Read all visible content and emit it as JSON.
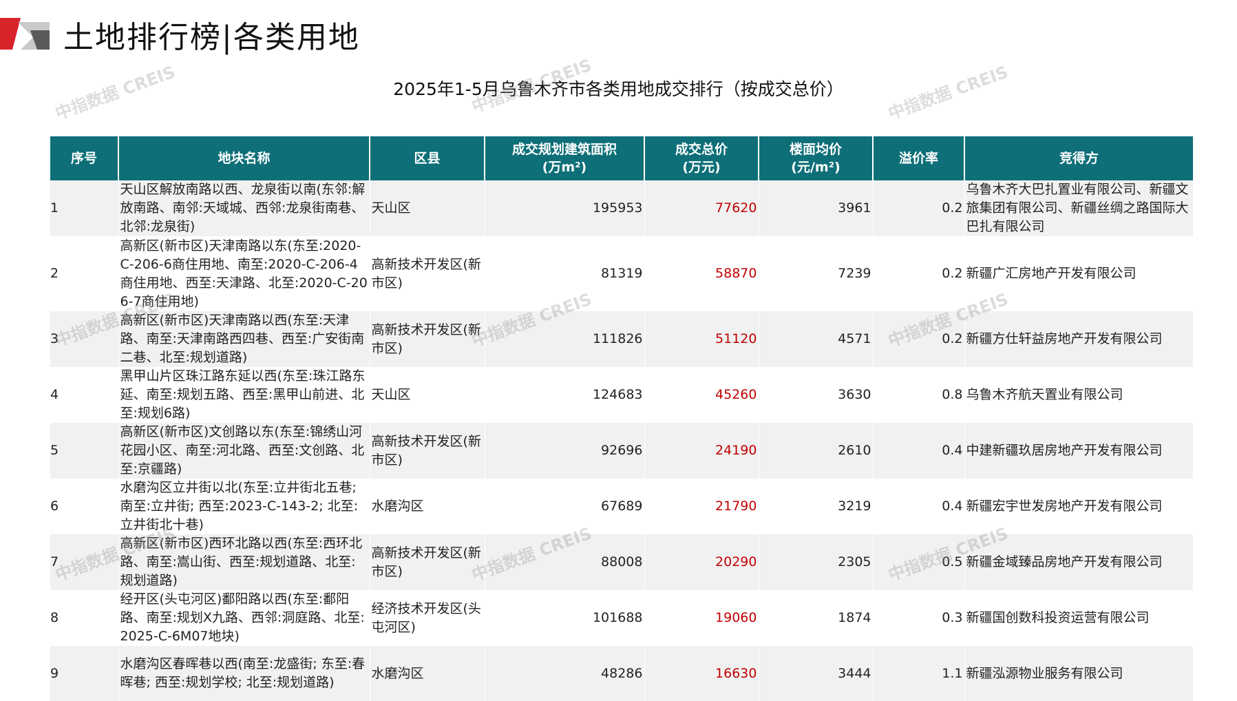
{
  "header": {
    "title": "土地排行榜|各类用地",
    "subtitle": "2025年1-5月乌鲁木齐市各类用地成交排行（按成交总价）",
    "watermark": "中指数据 CREIS"
  },
  "colors": {
    "header_bg": "#0e6f78",
    "price_red": "#c00000",
    "logo_red": "#d9232b"
  },
  "table": {
    "headers": [
      "序号",
      "地块名称",
      "区县",
      "成交规划建筑面积\n(万m²)",
      "成交总价\n(万元)",
      "楼面均价\n(元/m²)",
      "溢价率",
      "竞得方"
    ],
    "rows": [
      {
        "idx": "1",
        "name": "天山区解放南路以西、龙泉街以南(东邻:解放南路、南邻:天域城、西邻:龙泉街南巷、北邻:龙泉街)",
        "district": "天山区",
        "area": "195953",
        "price": "77620",
        "unit_price": "3961",
        "premium": "0.2",
        "winner": "乌鲁木齐大巴扎置业有限公司、新疆文旅集团有限公司、新疆丝绸之路国际大巴扎有限公司"
      },
      {
        "idx": "2",
        "name": "高新区(新市区)天津南路以东(东至:2020-C-206-6商住用地、南至:2020-C-206-4商住用地、西至:天津路、北至:2020-C-206-7商住用地)",
        "district": "高新技术开发区(新市区)",
        "area": "81319",
        "price": "58870",
        "unit_price": "7239",
        "premium": "0.2",
        "winner": "新疆广汇房地产开发有限公司"
      },
      {
        "idx": "3",
        "name": "高新区(新市区)天津南路以西(东至:天津路、南至:天津南路西四巷、西至:广安街南二巷、北至:规划道路)",
        "district": "高新技术开发区(新市区)",
        "area": "111826",
        "price": "51120",
        "unit_price": "4571",
        "premium": "0.2",
        "winner": "新疆方仕轩益房地产开发有限公司"
      },
      {
        "idx": "4",
        "name": "黑甲山片区珠江路东延以西(东至:珠江路东延、南至:规划五路、西至:黑甲山前进、北至:规划6路)",
        "district": "天山区",
        "area": "124683",
        "price": "45260",
        "unit_price": "3630",
        "premium": "0.8",
        "winner": "乌鲁木齐航天置业有限公司"
      },
      {
        "idx": "5",
        "name": "高新区(新市区)文创路以东(东至:锦绣山河花园小区、南至:河北路、西至:文创路、北至:京疆路)",
        "district": "高新技术开发区(新市区)",
        "area": "92696",
        "price": "24190",
        "unit_price": "2610",
        "premium": "0.4",
        "winner": "中建新疆玖居房地产开发有限公司"
      },
      {
        "idx": "6",
        "name": "水磨沟区立井街以北(东至:立井街北五巷; 南至:立井街; 西至:2023-C-143-2; 北至:立井街北十巷)",
        "district": "水磨沟区",
        "area": "67689",
        "price": "21790",
        "unit_price": "3219",
        "premium": "0.4",
        "winner": "新疆宏宇世发房地产开发有限公司"
      },
      {
        "idx": "7",
        "name": "高新区(新市区)西环北路以西(东至:西环北路、南至:嵩山街、西至:规划道路、北至:规划道路)",
        "district": "高新技术开发区(新市区)",
        "area": "88008",
        "price": "20290",
        "unit_price": "2305",
        "premium": "0.5",
        "winner": "新疆金域臻品房地产开发有限公司"
      },
      {
        "idx": "8",
        "name": "经开区(头屯河区)鄱阳路以西(东至:鄱阳路、南至:规划X九路、西邻:洞庭路、北至:2025-C-6M07地块)",
        "district": "经济技术开发区(头屯河区)",
        "area": "101688",
        "price": "19060",
        "unit_price": "1874",
        "premium": "0.3",
        "winner": "新疆国创数科投资运营有限公司"
      },
      {
        "idx": "9",
        "name": "水磨沟区春晖巷以西(南至:龙盛街; 东至:春晖巷; 西至:规划学校; 北至:规划道路)",
        "district": "水磨沟区",
        "area": "48286",
        "price": "16630",
        "unit_price": "3444",
        "premium": "1.1",
        "winner": "新疆泓源物业服务有限公司"
      }
    ]
  }
}
